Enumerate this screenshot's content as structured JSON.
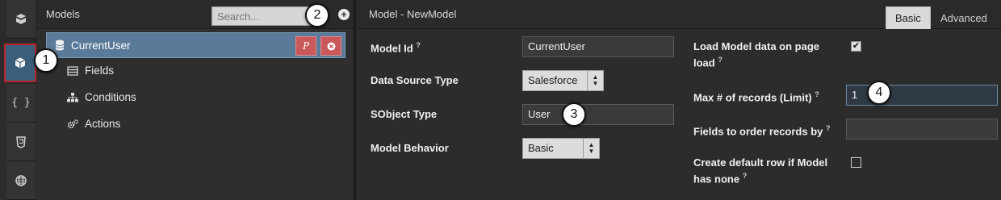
{
  "rail": {
    "items": [
      {
        "icon": "cube-stack-icon"
      },
      {
        "icon": "cube-icon",
        "active": true
      },
      {
        "icon": "braces-icon",
        "label": "{ }"
      },
      {
        "icon": "css3-icon"
      },
      {
        "icon": "globe-icon"
      }
    ]
  },
  "models": {
    "title": "Models",
    "search_placeholder": "Search...",
    "selected_model": "CurrentUser",
    "tree": [
      {
        "label": "Fields",
        "icon": "list-icon"
      },
      {
        "label": "Conditions",
        "icon": "sitemap-icon"
      },
      {
        "label": "Actions",
        "icon": "gears-icon"
      }
    ],
    "row_buttons": [
      "params-icon",
      "remove-icon"
    ]
  },
  "callouts": [
    "1",
    "2",
    "3",
    "4"
  ],
  "main": {
    "title": "Model - NewModel",
    "tabs": [
      {
        "label": "Basic",
        "active": true
      },
      {
        "label": "Advanced",
        "active": false
      }
    ],
    "fields": {
      "model_id": {
        "label": "Model Id",
        "value": "CurrentUser"
      },
      "data_source_type": {
        "label": "Data Source Type",
        "value": "Salesforce"
      },
      "sobject_type": {
        "label": "SObject Type",
        "value": "User"
      },
      "model_behavior": {
        "label": "Model Behavior",
        "value": "Basic"
      },
      "load_on_page": {
        "label_line1": "Load Model data on page",
        "label_line2": "load",
        "checked": true
      },
      "max_records": {
        "label": "Max # of records (Limit)",
        "value": "1"
      },
      "order_fields": {
        "label": "Fields to order records by",
        "value": ""
      },
      "create_default_row": {
        "label_line1": "Create default row if Model",
        "label_line2": "has none",
        "checked": false
      }
    }
  },
  "colors": {
    "selected_row": "#597a99",
    "active_rail": "#3b5f7b",
    "danger_button": "#c9585a",
    "callout_outline": "#b8232a"
  }
}
